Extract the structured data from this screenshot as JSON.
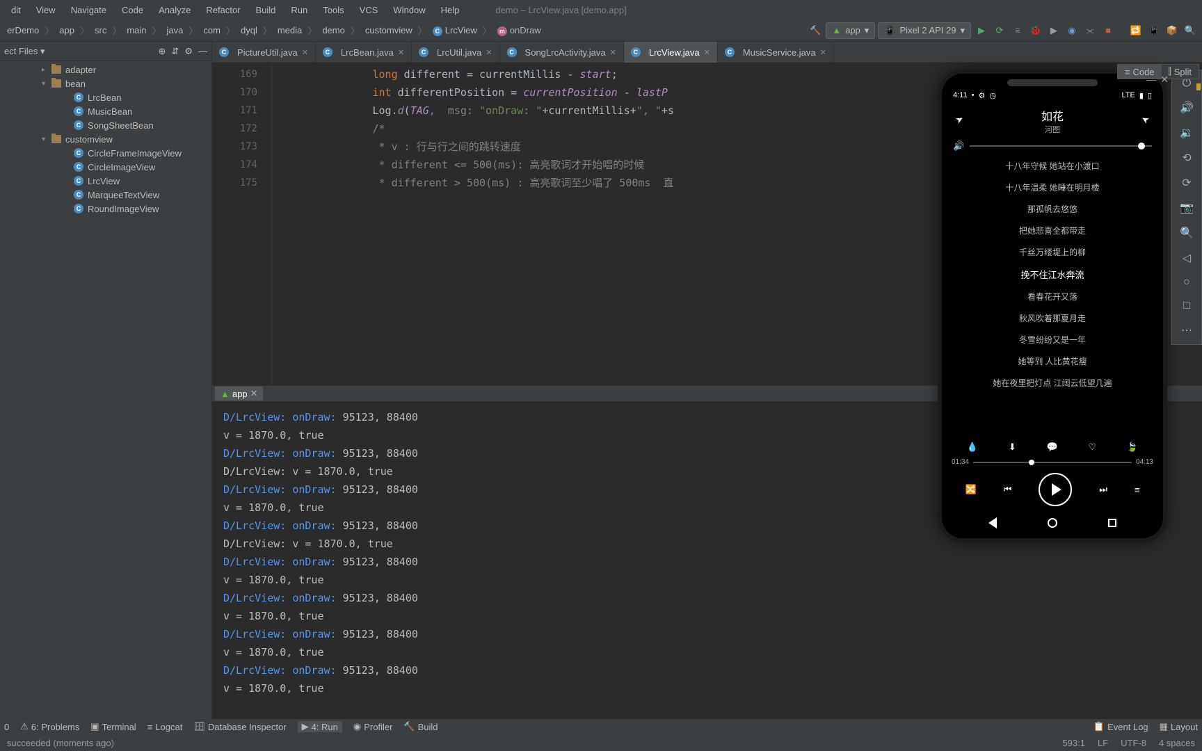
{
  "menu": {
    "items": [
      "dit",
      "View",
      "Navigate",
      "Code",
      "Analyze",
      "Refactor",
      "Build",
      "Run",
      "Tools",
      "VCS",
      "Window",
      "Help"
    ],
    "title": "demo – LrcView.java [demo.app]"
  },
  "breadcrumbs": [
    "erDemo",
    "app",
    "src",
    "main",
    "java",
    "com",
    "dyql",
    "media",
    "demo",
    "customview",
    "LrcView",
    "onDraw"
  ],
  "run_config": "app",
  "device": "Pixel 2 API 29",
  "project": {
    "dropdown": "ect Files",
    "folders": {
      "adapter": "adapter",
      "bean": "bean",
      "customview": "customview"
    },
    "bean_items": [
      "LrcBean",
      "MusicBean",
      "SongSheetBean"
    ],
    "cv_items": [
      "CircleFrameImageView",
      "CircleImageView",
      "LrcView",
      "MarqueeTextView",
      "RoundImageView"
    ]
  },
  "tabs": [
    {
      "name": "PictureUtil.java"
    },
    {
      "name": "LrcBean.java"
    },
    {
      "name": "LrcUtil.java"
    },
    {
      "name": "SongLrcActivity.java"
    },
    {
      "name": "LrcView.java",
      "active": true
    },
    {
      "name": "MusicService.java"
    }
  ],
  "view_modes": {
    "code": "Code",
    "split": "Split"
  },
  "gutter": [
    "169",
    "170",
    "171",
    "172",
    "173",
    "174",
    "175"
  ],
  "code_lines": {
    "l1_kw": "long",
    "l1_rest": " different = currentMillis - ",
    "l1_var": "start",
    "l1_end": ";",
    "l2_kw": "int",
    "l2_rest": " differentPosition = ",
    "l2_var1": "currentPosition",
    "l2_mid": " - ",
    "l2_var2": "lastP",
    "l3_a": "Log.",
    "l3_b": "d",
    "l3_c": "(",
    "l3_tag": "TAG",
    "l3_p": ",  msg: ",
    "l3_s": "\"onDraw: \"",
    "l3_rest": "+currentMillis+",
    "l3_s2": "\", \"",
    "l3_end": "+s",
    "l4": "/*",
    "l5": " * v : 行与行之间的跳转速度",
    "l6": " * different <= 500(ms): 高亮歌词才开始唱的时候",
    "l7": " * different > 500(ms) : 高亮歌词至少唱了 500ms  直"
  },
  "run_tab": "app",
  "log_lines": [
    "D/LrcView: onDraw: 95123, 88400",
    "      v = 1870.0, true",
    "D/LrcView: onDraw: 95123, 88400",
    "D/LrcView: v = 1870.0, true",
    "D/LrcView: onDraw: 95123, 88400",
    "      v = 1870.0, true",
    "D/LrcView: onDraw: 95123, 88400",
    "D/LrcView: v = 1870.0, true",
    "D/LrcView: onDraw: 95123, 88400",
    "      v = 1870.0, true",
    "D/LrcView: onDraw: 95123, 88400",
    "      v = 1870.0, true",
    "D/LrcView: onDraw: 95123, 88400",
    "      v = 1870.0, true",
    "D/LrcView: onDraw: 95123, 88400",
    "      v = 1870.0, true"
  ],
  "phone": {
    "time": "4:11",
    "lte": "LTE",
    "title": "如花",
    "subtitle": "河图",
    "lyrics": [
      "十八年守候 她站在小渡口",
      "十八年温柔 她睡在明月楼",
      "那孤帆去悠悠",
      "把她悲喜全都带走",
      "千丝万缕堤上的柳",
      "挽不住江水奔流",
      "看春花开又落",
      "秋风吹着那夏月走",
      "冬雪纷纷又是一年",
      "她等到 人比黄花瘦",
      "她在夜里把灯点 江阔云低望几遍"
    ],
    "active_lyric_index": 5,
    "time_cur": "01:34",
    "time_total": "04:13"
  },
  "bottom_tools": [
    "0",
    "6: Problems",
    "Terminal",
    "Logcat",
    "Database Inspector",
    "4: Run",
    "Profiler",
    "Build"
  ],
  "bottom_right": [
    "Event Log",
    "Layout"
  ],
  "status_left": "succeeded (moments ago)",
  "status_right": [
    "593:1",
    "LF",
    "UTF-8",
    "4 spaces"
  ]
}
